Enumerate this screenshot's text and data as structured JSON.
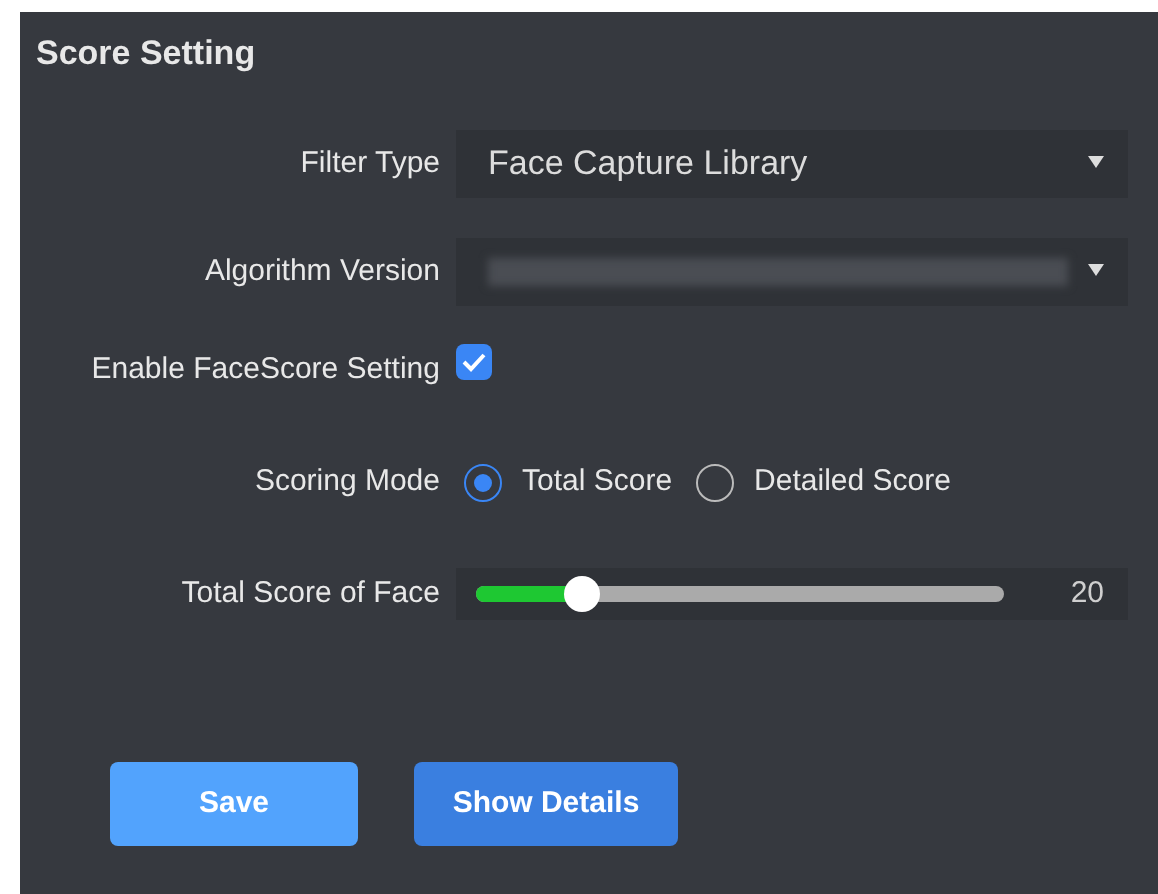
{
  "panel": {
    "title": "Score Setting"
  },
  "filter_type": {
    "label": "Filter Type",
    "value": "Face Capture Library"
  },
  "algorithm_version": {
    "label": "Algorithm Version"
  },
  "enable_facescore": {
    "label": "Enable FaceScore Setting",
    "checked": true
  },
  "scoring_mode": {
    "label": "Scoring Mode",
    "options": [
      {
        "label": "Total Score",
        "selected": true
      },
      {
        "label": "Detailed Score",
        "selected": false
      }
    ]
  },
  "total_score": {
    "label": "Total Score of Face",
    "level": 0.2,
    "reading": "20"
  },
  "buttons": [
    {
      "label": "Save",
      "kind": "light"
    },
    {
      "label": "Show Details",
      "kind": "dark"
    }
  ]
}
